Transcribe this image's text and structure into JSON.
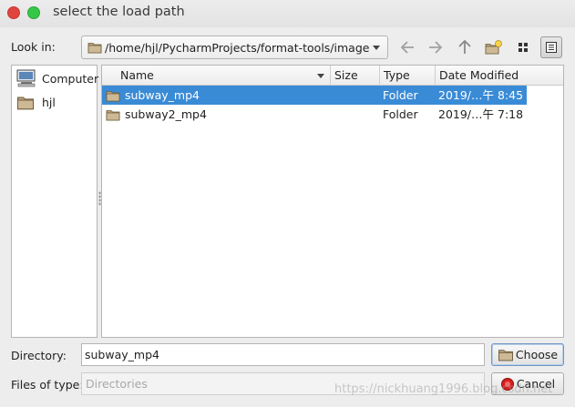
{
  "window": {
    "title": "select the load path"
  },
  "toolbar": {
    "look_in_label": "Look in:",
    "path": "/home/hjl/PycharmProjects/format-tools/image",
    "icons": [
      "back-arrow-icon",
      "forward-arrow-icon",
      "parent-directory-icon",
      "new-folder-icon",
      "icon-view-icon",
      "detail-view-icon"
    ]
  },
  "sidebar": {
    "items": [
      {
        "label": "Computer",
        "icon": "computer-icon"
      },
      {
        "label": "hjl",
        "icon": "folder-icon"
      }
    ]
  },
  "file_list": {
    "columns": [
      "Name",
      "Size",
      "Type",
      "Date Modified"
    ],
    "rows": [
      {
        "name": "subway_mp4",
        "size": "",
        "type": "Folder",
        "date": "2019/…午 8:45",
        "selected": true
      },
      {
        "name": "subway2_mp4",
        "size": "",
        "type": "Folder",
        "date": "2019/…午 7:18",
        "selected": false
      }
    ]
  },
  "footer": {
    "directory_label": "Directory:",
    "directory_value": "subway_mp4",
    "files_of_type_label": "Files of type:",
    "files_of_type_value": "Directories",
    "choose_label": "Choose",
    "cancel_label": "Cancel"
  },
  "watermark": "https://nickhuang1996.blog.csdn.net",
  "colors": {
    "selection": "#3a8bd6",
    "close": "#e0443e",
    "maximize": "#35c848"
  }
}
